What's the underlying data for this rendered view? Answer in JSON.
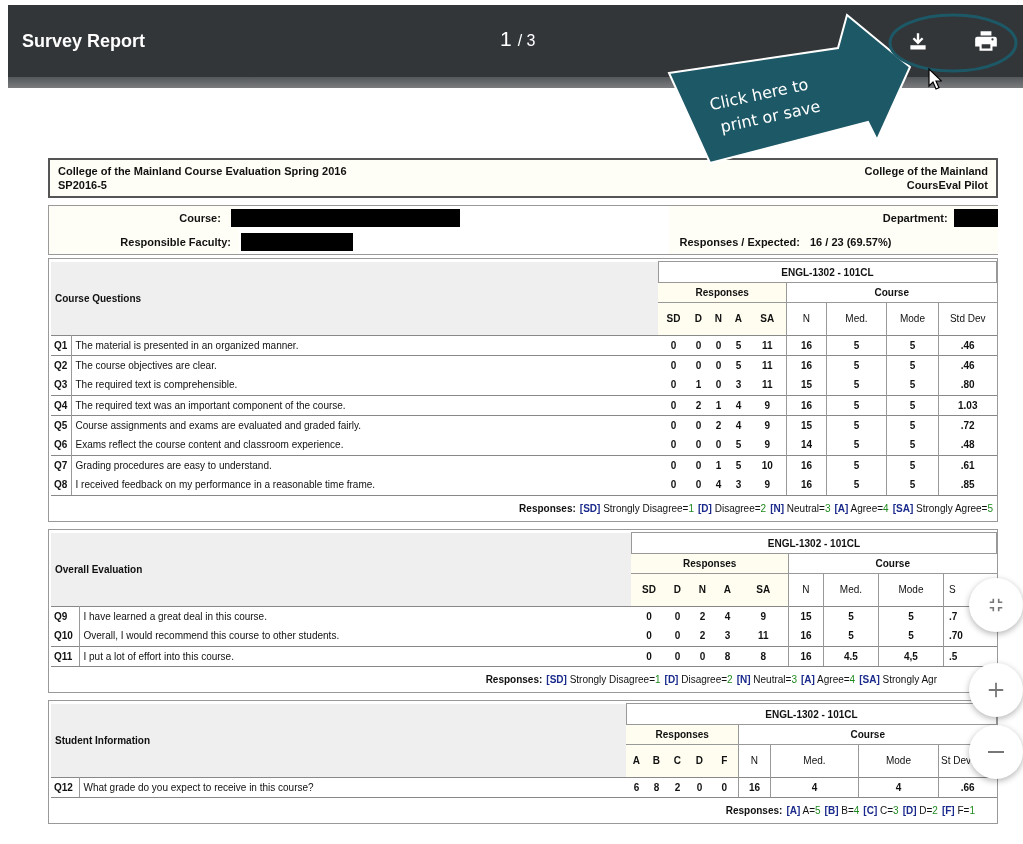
{
  "toolbar": {
    "title": "Survey Report",
    "page": "1",
    "page_total": "/ 3"
  },
  "callout": {
    "lines": [
      "Click here to",
      "print or save"
    ]
  },
  "report_header": {
    "left": [
      "College of the Mainland Course Evaluation Spring 2016",
      "SP2016-5"
    ],
    "right": [
      "College of the Mainland",
      "CoursEval Pilot"
    ]
  },
  "info": {
    "course_label": "Course:",
    "faculty_label": "Responsible Faculty:",
    "department_label": "Department:",
    "responses_label": "Responses / Expected:",
    "responses_value": "16 / 23 (69.57%)"
  },
  "sections": [
    {
      "title": "Course Questions",
      "offering": "ENGL-1302 - 101CL",
      "response_group": "Responses",
      "course_group": "Course",
      "response_columns": [
        "SD",
        "D",
        "N",
        "A",
        "SA"
      ],
      "course_columns": [
        "N",
        "Med.",
        "Mode",
        "Std Dev"
      ],
      "rows": [
        {
          "num": "Q1",
          "text": "The material is presented in an organized manner.",
          "rule_above": true,
          "responses": [
            "0",
            "0",
            "0",
            "5",
            "11"
          ],
          "course": [
            "16",
            "5",
            "5",
            ".46"
          ]
        },
        {
          "num": "Q2",
          "text": "The course objectives are clear.",
          "rule_above": true,
          "responses": [
            "0",
            "0",
            "0",
            "5",
            "11"
          ],
          "course": [
            "16",
            "5",
            "5",
            ".46"
          ]
        },
        {
          "num": "Q3",
          "text": "The required text is comprehensible.",
          "rule_above": false,
          "responses": [
            "0",
            "1",
            "0",
            "3",
            "11"
          ],
          "course": [
            "15",
            "5",
            "5",
            ".80"
          ]
        },
        {
          "num": "Q4",
          "text": "The required text was an important component of the course.",
          "rule_above": true,
          "responses": [
            "0",
            "2",
            "1",
            "4",
            "9"
          ],
          "course": [
            "16",
            "5",
            "5",
            "1.03"
          ]
        },
        {
          "num": "Q5",
          "text": "Course assignments and exams are evaluated and graded fairly.",
          "rule_above": true,
          "responses": [
            "0",
            "0",
            "2",
            "4",
            "9"
          ],
          "course": [
            "15",
            "5",
            "5",
            ".72"
          ]
        },
        {
          "num": "Q6",
          "text": "Exams reflect the course content and classroom experience.",
          "rule_above": false,
          "responses": [
            "0",
            "0",
            "0",
            "5",
            "9"
          ],
          "course": [
            "14",
            "5",
            "5",
            ".48"
          ]
        },
        {
          "num": "Q7",
          "text": "Grading procedures are easy to understand.",
          "rule_above": true,
          "responses": [
            "0",
            "0",
            "1",
            "5",
            "10"
          ],
          "course": [
            "16",
            "5",
            "5",
            ".61"
          ]
        },
        {
          "num": "Q8",
          "text": "I received feedback on my performance in a reasonable time frame.",
          "rule_above": false,
          "responses": [
            "0",
            "0",
            "4",
            "3",
            "9"
          ],
          "course": [
            "16",
            "5",
            "5",
            ".85"
          ]
        }
      ],
      "legend": {
        "label": "Responses:",
        "items": [
          {
            "code": "[SD]",
            "text": "Strongly Disagree=",
            "value": "1"
          },
          {
            "code": "[D]",
            "text": "Disagree=",
            "value": "2"
          },
          {
            "code": "[N]",
            "text": "Neutral=",
            "value": "3"
          },
          {
            "code": "[A]",
            "text": "Agree=",
            "value": "4"
          },
          {
            "code": "[SA]",
            "text": "Strongly Agree=",
            "value": "5"
          }
        ]
      }
    },
    {
      "title": "Overall Evaluation",
      "offering": "ENGL-1302 - 101CL",
      "response_group": "Responses",
      "course_group": "Course",
      "response_columns": [
        "SD",
        "D",
        "N",
        "A",
        "SA"
      ],
      "course_columns": [
        "N",
        "Med.",
        "Mode",
        "S"
      ],
      "rows": [
        {
          "num": "Q9",
          "text": "I have learned a great deal in this course.",
          "rule_above": true,
          "responses": [
            "0",
            "0",
            "2",
            "4",
            "9"
          ],
          "course": [
            "15",
            "5",
            "5",
            ".7"
          ]
        },
        {
          "num": "Q10",
          "text": "Overall, I would recommend this course to other students.",
          "rule_above": false,
          "responses": [
            "0",
            "0",
            "2",
            "3",
            "11"
          ],
          "course": [
            "16",
            "5",
            "5",
            ".70"
          ]
        },
        {
          "num": "Q11",
          "text": "I put a lot of effort into this course.",
          "rule_above": true,
          "responses": [
            "0",
            "0",
            "0",
            "8",
            "8"
          ],
          "course": [
            "16",
            "4.5",
            "4,5",
            ".5"
          ]
        }
      ],
      "legend": {
        "label": "Responses:",
        "items": [
          {
            "code": "[SD]",
            "text": "Strongly Disagree=",
            "value": "1"
          },
          {
            "code": "[D]",
            "text": "Disagree=",
            "value": "2"
          },
          {
            "code": "[N]",
            "text": "Neutral=",
            "value": "3"
          },
          {
            "code": "[A]",
            "text": "Agree=",
            "value": "4"
          },
          {
            "code": "[SA]",
            "text": "Strongly Agr"
          }
        ]
      }
    },
    {
      "title": "Student Information",
      "offering": "ENGL-1302 - 101CL",
      "response_group": "Responses",
      "course_group": "Course",
      "response_columns": [
        "A",
        "B",
        "C",
        "D",
        "F"
      ],
      "course_columns": [
        "N",
        "Med.",
        "Mode",
        "St Dev"
      ],
      "rows": [
        {
          "num": "Q12",
          "text": "What grade do you expect to receive in this course?",
          "rule_above": true,
          "responses": [
            "6",
            "8",
            "2",
            "0",
            "0"
          ],
          "course": [
            "16",
            "4",
            "4",
            ".66"
          ]
        }
      ],
      "legend": {
        "label": "Responses:",
        "items": [
          {
            "code": "[A]",
            "text": "A=",
            "value": "5"
          },
          {
            "code": "[B]",
            "text": "B=",
            "value": "4"
          },
          {
            "code": "[C]",
            "text": "C=",
            "value": "3"
          },
          {
            "code": "[D]",
            "text": "D=",
            "value": "2"
          },
          {
            "code": "[F]",
            "text": "F=",
            "value": "1"
          }
        ]
      }
    }
  ]
}
